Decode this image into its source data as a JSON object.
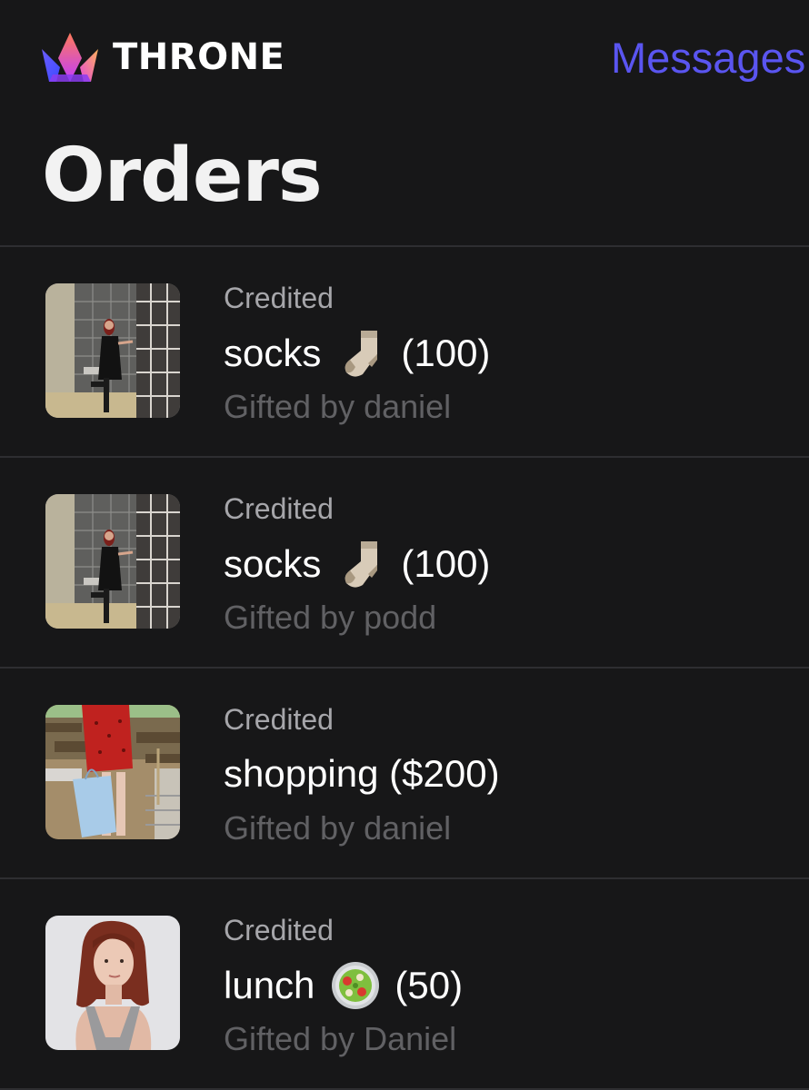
{
  "header": {
    "brand": "THRONE",
    "messages_link": "Messages"
  },
  "page_title": "Orders",
  "colors": {
    "background": "#171718",
    "accent": "#5a55f0",
    "status_text": "#a6a6aa",
    "secondary_text": "#616164",
    "divider": "#2e2e31"
  },
  "orders": [
    {
      "status": "Credited",
      "item": "socks",
      "emoji": "sock-emoji",
      "amount": "(100)",
      "gifter": "Gifted by daniel",
      "thumbnail": "photo-person-in-shower-room"
    },
    {
      "status": "Credited",
      "item": "socks",
      "emoji": "sock-emoji",
      "amount": "(100)",
      "gifter": "Gifted by podd",
      "thumbnail": "photo-person-in-shower-room"
    },
    {
      "status": "Credited",
      "item": "shopping ($200)",
      "emoji": "",
      "amount": "",
      "gifter": "Gifted by daniel",
      "thumbnail": "photo-red-dress-shopping-bag"
    },
    {
      "status": "Credited",
      "item": "lunch",
      "emoji": "salad-emoji",
      "amount": "(50)",
      "gifter": "Gifted by Daniel",
      "thumbnail": "photo-portrait-red-hair"
    }
  ]
}
